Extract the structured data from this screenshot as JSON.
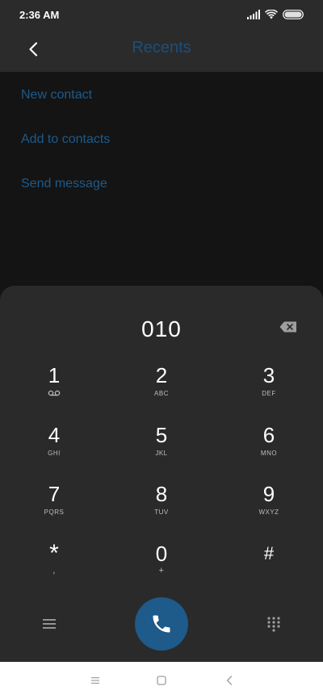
{
  "status_bar": {
    "time": "2:36 AM",
    "icons": [
      "signal-icon",
      "wifi-icon",
      "battery-icon"
    ]
  },
  "header": {
    "title": "Recents",
    "back_icon": "chevron-left-icon"
  },
  "actions": [
    {
      "label": "New contact"
    },
    {
      "label": "Add to contacts"
    },
    {
      "label": "Send message"
    }
  ],
  "dialer": {
    "number": "010",
    "backspace_icon": "backspace-icon",
    "keys": [
      {
        "digit": "1",
        "sub": ""
      },
      {
        "digit": "2",
        "sub": "ABC"
      },
      {
        "digit": "3",
        "sub": "DEF"
      },
      {
        "digit": "4",
        "sub": "GHI"
      },
      {
        "digit": "5",
        "sub": "JKL"
      },
      {
        "digit": "6",
        "sub": "MNO"
      },
      {
        "digit": "7",
        "sub": "PQRS"
      },
      {
        "digit": "8",
        "sub": "TUV"
      },
      {
        "digit": "9",
        "sub": "WXYZ"
      },
      {
        "digit": "*",
        "sub": ","
      },
      {
        "digit": "0",
        "sub": "+"
      },
      {
        "digit": "#",
        "sub": ""
      }
    ],
    "call_icon": "phone-icon",
    "menu_icon": "menu-icon",
    "keypad_icon": "dialpad-icon"
  },
  "nav_bar": {
    "icons": [
      "recent-apps-icon",
      "home-icon",
      "back-icon"
    ]
  },
  "colors": {
    "accent": "#1e5a8a",
    "background": "#141414",
    "surface": "#2a2a2a"
  }
}
